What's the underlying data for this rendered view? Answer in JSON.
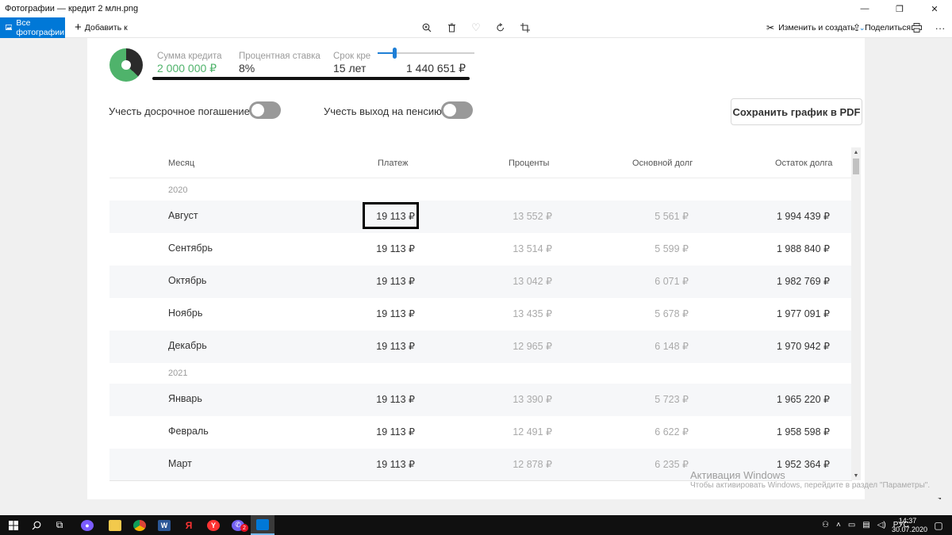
{
  "window": {
    "title": "Фотографии — кредит 2 млн.png",
    "minimize": "—",
    "maximize": "❐",
    "close": "✕"
  },
  "toolbar": {
    "all_photos": "Все фотографии",
    "add_to": "Добавить к",
    "edit_create": "Изменить и создать",
    "share": "Поделиться",
    "icons": [
      "zoom-icon",
      "delete-icon",
      "favorite-icon",
      "rotate-icon",
      "crop-icon",
      "print-icon",
      "more-icon"
    ]
  },
  "summary": {
    "loan_amount_label": "Сумма кредита",
    "loan_amount_value": "2 000 000 ₽",
    "rate_label": "Процентная ставка",
    "rate_value": "8%",
    "term_label": "Срок кре",
    "term_value": "15 лет",
    "overpayment_value": "1 440 651 ₽",
    "donut_dark_share": 0.37,
    "colors": {
      "green": "#4fb36b",
      "dark": "#2b2b2b",
      "accent": "#1f7fd6"
    }
  },
  "options": {
    "early_repayment": "Учесть досрочное погашение",
    "early_repayment_on": false,
    "retirement": "Учесть выход на пенсию",
    "retirement_on": false,
    "save_pdf": "Сохранить график в PDF"
  },
  "table": {
    "headers": [
      "Месяц",
      "Платеж",
      "Проценты",
      "Основной долг",
      "Остаток долга"
    ],
    "years": [
      "2020",
      "2021"
    ],
    "rows_2020": [
      [
        "Август",
        "19 113 ₽",
        "13 552 ₽",
        "5 561 ₽",
        "1 994 439 ₽"
      ],
      [
        "Сентябрь",
        "19 113 ₽",
        "13 514 ₽",
        "5 599 ₽",
        "1 988 840 ₽"
      ],
      [
        "Октябрь",
        "19 113 ₽",
        "13 042 ₽",
        "6 071 ₽",
        "1 982 769 ₽"
      ],
      [
        "Ноябрь",
        "19 113 ₽",
        "13 435 ₽",
        "5 678 ₽",
        "1 977 091 ₽"
      ],
      [
        "Декабрь",
        "19 113 ₽",
        "12 965 ₽",
        "6 148 ₽",
        "1 970 942 ₽"
      ]
    ],
    "rows_2021": [
      [
        "Январь",
        "19 113 ₽",
        "13 390 ₽",
        "5 723 ₽",
        "1 965 220 ₽"
      ],
      [
        "Февраль",
        "19 113 ₽",
        "12 491 ₽",
        "6 622 ₽",
        "1 958 598 ₽"
      ],
      [
        "Март",
        "19 113 ₽",
        "12 878 ₽",
        "6 235 ₽",
        "1 952 364 ₽"
      ]
    ]
  },
  "watermark": {
    "title": "Активация Windows",
    "subtitle": "Чтобы активировать Windows, перейдите в раздел \"Параметры\"."
  },
  "taskbar": {
    "lang": "РУС",
    "time": "14:37",
    "date": "30.07.2020",
    "viber_badge": "2"
  }
}
